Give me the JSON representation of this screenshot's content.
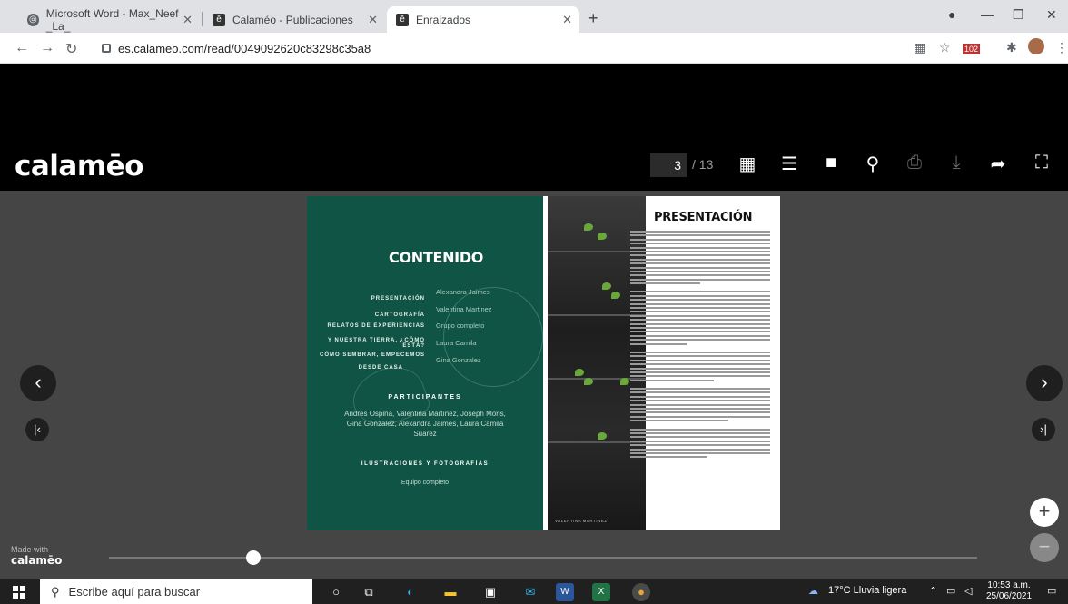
{
  "browser": {
    "tabs": [
      {
        "title": "Microsoft Word - Max_Neef _La_",
        "icon": "chrome-icon"
      },
      {
        "title": "Calaméo - Publicaciones",
        "icon": "calameo-icon"
      },
      {
        "title": "Enraizados",
        "icon": "calameo-icon"
      }
    ],
    "url": "es.calameo.com/read/0049092620c83298c35a8",
    "ext_badge": "102"
  },
  "viewer": {
    "logo": "calamēo",
    "current_page": "3",
    "total_pages": "/ 13",
    "made_with": "Made with",
    "made_brand": "calamēo"
  },
  "left_page": {
    "title": "CONTENIDO",
    "toc_left": [
      "PRESENTACIÓN",
      "CARTOGRAFÍA",
      "RELATOS DE EXPERIENCIAS",
      "Y NUESTRA TIERRA, ¿CÓMO ESTÁ?",
      "CÓMO SEMBRAR, EMPECEMOS",
      "DESDE CASA"
    ],
    "toc_right": [
      "Alexandra Jaimes",
      "Valentina Martinez",
      "Grupo completo",
      "Laura Camila",
      "Gina Gonzalez"
    ],
    "participants_title": "PARTICIPANTES",
    "participants": "Andrés Ospina, Valentina Martínez, Joseph Moris, Gina Gonzalez, Alexandra Jaimes, Laura Camila Suárez",
    "illustrations_title": "ILUSTRACIONES Y FOTOGRAFÍAS",
    "illustrations_sub": "Equipo completo"
  },
  "right_page": {
    "title": "PRESENTACIÓN",
    "photo_caption": "VALENTINA MARTINEZ"
  },
  "taskbar": {
    "search_placeholder": "Escribe aquí para buscar",
    "weather": "17°C  Lluvia ligera",
    "time": "10:53 a.m.",
    "date": "25/06/2021"
  },
  "colors": {
    "page_green": "#0f5444",
    "stage_bg": "#454545"
  }
}
